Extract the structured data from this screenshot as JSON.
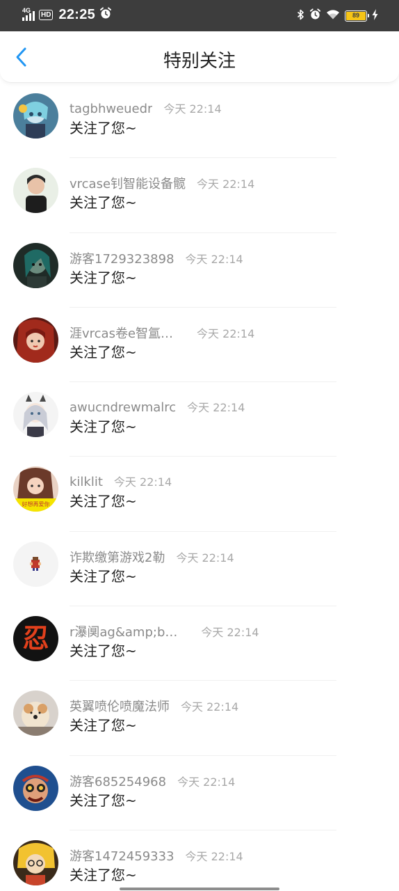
{
  "status_bar": {
    "network": "4G",
    "hd": "HD",
    "time": "22:25",
    "battery_level": "89",
    "battery_color": "#f6c417"
  },
  "header": {
    "title": "特别关注",
    "back_icon": "chevron-left-icon",
    "accent_color": "#2196f3"
  },
  "notifications": [
    {
      "username": "tagbhweuedr",
      "time": "今天 22:14",
      "message": "关注了您~"
    },
    {
      "username": "vrcase钊智能设备髋",
      "time": "今天 22:14",
      "message": "关注了您~"
    },
    {
      "username": "游客1729323898",
      "time": "今天 22:14",
      "message": "关注了您~"
    },
    {
      "username": "涯vrcas卷e智氲…",
      "time": "今天 22:14",
      "message": "关注了您~"
    },
    {
      "username": "awucndrewmalrc",
      "time": "今天 22:14",
      "message": "关注了您~"
    },
    {
      "username": "kilklit",
      "time": "今天 22:14",
      "message": "关注了您~",
      "avatar_text": "好想再爱你"
    },
    {
      "username": "诈欺缴第游戏2勒",
      "time": "今天 22:14",
      "message": "关注了您~"
    },
    {
      "username": "r瀑阒ag&amp;b…",
      "time": "今天 22:14",
      "message": "关注了您~",
      "avatar_text": "忍"
    },
    {
      "username": "英翼喷伦喷魔法师",
      "time": "今天 22:14",
      "message": "关注了您~"
    },
    {
      "username": "游客685254968",
      "time": "今天 22:14",
      "message": "关注了您~"
    },
    {
      "username": "游客1472459333",
      "time": "今天 22:14",
      "message": "关注了您~"
    }
  ]
}
